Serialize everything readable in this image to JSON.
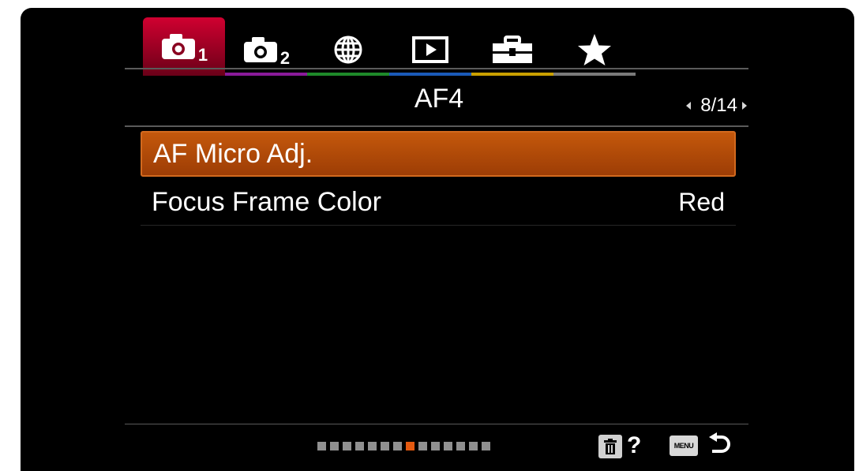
{
  "tabs": [
    {
      "icon": "camera-settings-1-icon",
      "sub": "1",
      "stripe": "#c0002a",
      "active": true
    },
    {
      "icon": "camera-settings-2-icon",
      "sub": "2",
      "stripe": "#8a1a9a",
      "active": false
    },
    {
      "icon": "network-icon",
      "sub": "",
      "stripe": "#1e8a2a",
      "active": false
    },
    {
      "icon": "playback-icon",
      "sub": "",
      "stripe": "#1a5ab8",
      "active": false
    },
    {
      "icon": "setup-toolbox-icon",
      "sub": "",
      "stripe": "#c9a000",
      "active": false
    },
    {
      "icon": "my-menu-star-icon",
      "sub": "",
      "stripe": "#7a7a7a",
      "active": false
    }
  ],
  "header": {
    "title": "AF4",
    "page": "8/14"
  },
  "menu_items": [
    {
      "label": "AF Micro Adj.",
      "value": "",
      "selected": true
    },
    {
      "label": "Focus Frame Color",
      "value": "Red",
      "selected": false
    }
  ],
  "footer": {
    "page_count": 14,
    "current_page": 8,
    "help_mark": "?",
    "menu_label": "MENU"
  },
  "colors": {
    "accent_orange": "#c4580c",
    "tab1_red": "#c0002a"
  }
}
